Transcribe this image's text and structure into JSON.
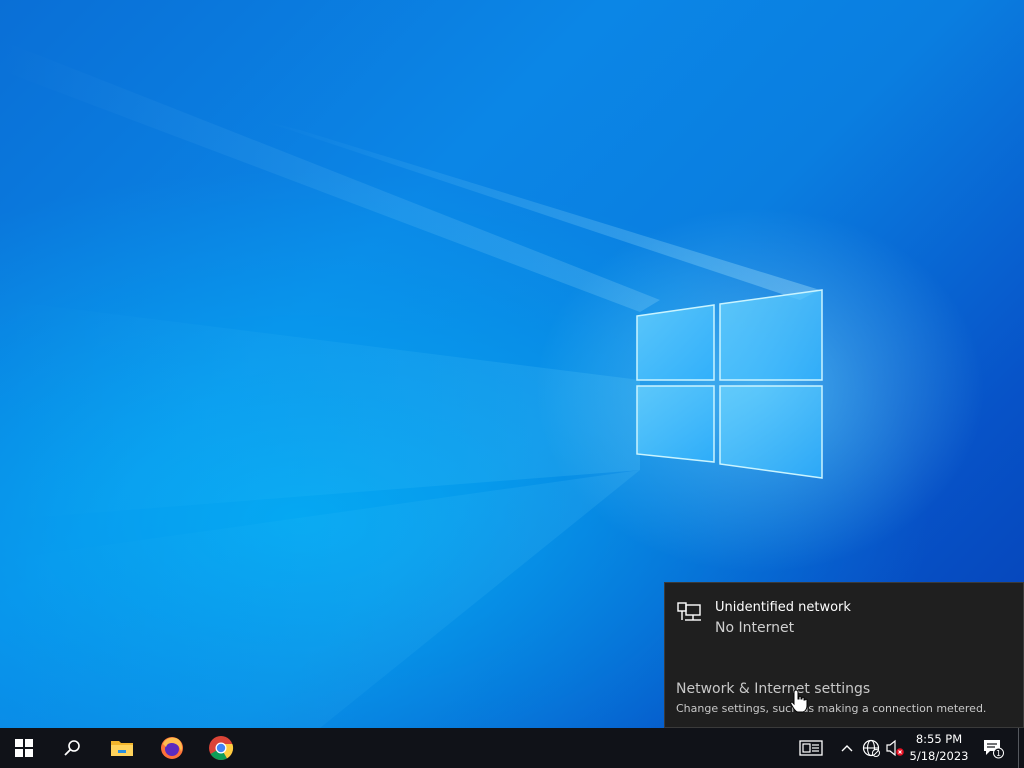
{
  "network_flyout": {
    "network_name": "Unidentified network",
    "network_status": "No Internet",
    "settings_link": "Network & Internet settings",
    "settings_description": "Change settings, such as making a connection metered.",
    "icons": {
      "network": "wired-network-icon"
    }
  },
  "taskbar": {
    "pinned": [
      {
        "name": "start-button",
        "icon": "windows-logo-icon"
      },
      {
        "name": "search-button",
        "icon": "search-icon"
      },
      {
        "name": "file-explorer-button",
        "icon": "folder-icon"
      },
      {
        "name": "firefox-button",
        "icon": "firefox-icon"
      },
      {
        "name": "chrome-button",
        "icon": "chrome-icon"
      }
    ],
    "tray": {
      "icons": [
        "news-and-interests-icon",
        "chevron-up-icon",
        "network-globe-icon",
        "volume-muted-icon"
      ],
      "time": "8:55 PM",
      "date": "5/18/2023",
      "notification_count": "1"
    }
  },
  "colors": {
    "wallpaper_blue": "#0a7ee0",
    "taskbar": "#101218",
    "flyout_bg": "#1f1f1f",
    "accent_red": "#e81123"
  }
}
